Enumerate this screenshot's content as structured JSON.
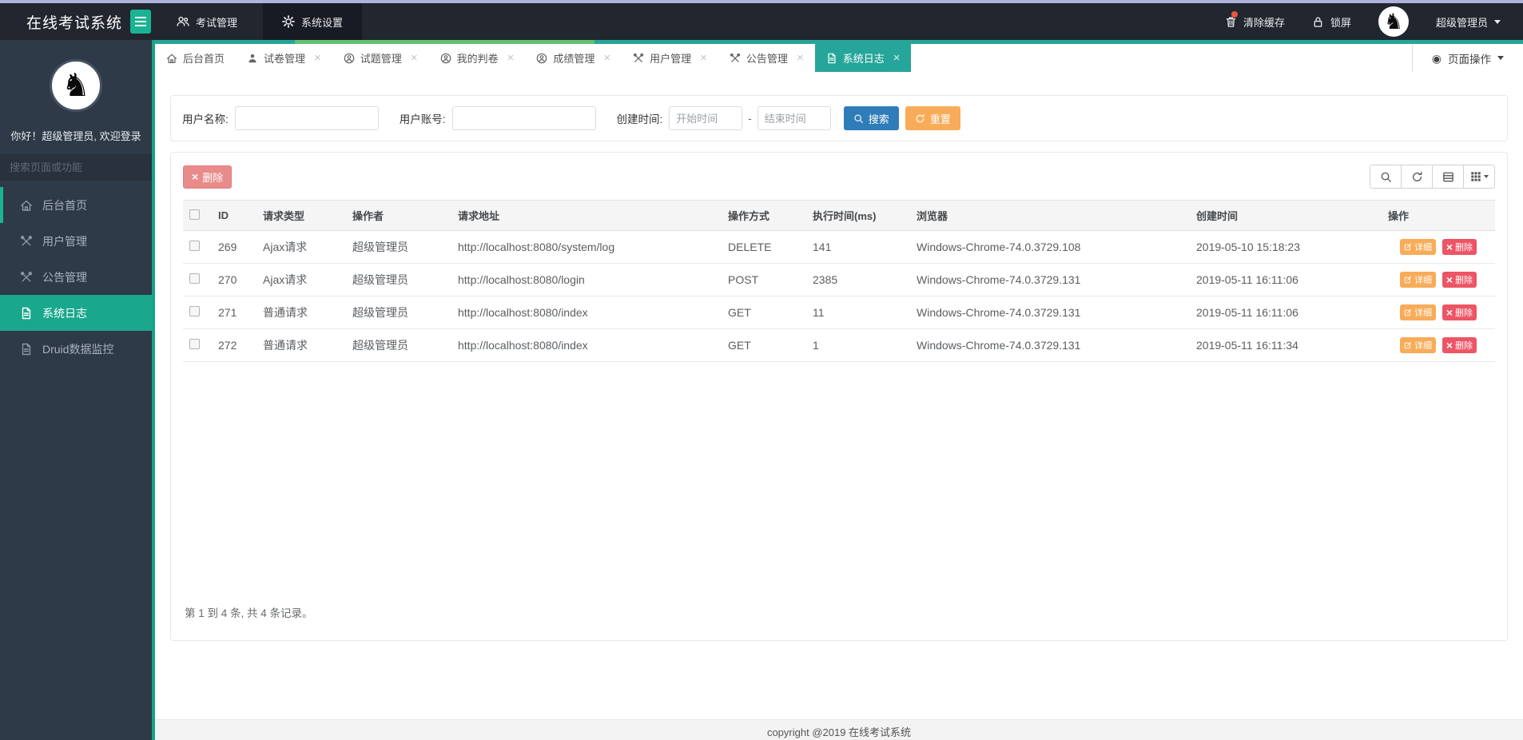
{
  "topbar": {
    "title": "在线考试系统",
    "nav": [
      {
        "label": "考试管理",
        "icon": "users-icon"
      },
      {
        "label": "系统设置",
        "icon": "gear-icon",
        "active": true
      }
    ],
    "actions": {
      "clear_cache": "清除缓存",
      "lock_screen": "锁屏",
      "username": "超级管理员"
    }
  },
  "sidebar": {
    "greeting": "你好！超级管理员, 欢迎登录",
    "search_placeholder": "搜索页面或功能",
    "items": [
      {
        "label": "后台首页",
        "icon": "home-icon"
      },
      {
        "label": "用户管理",
        "icon": "tools-icon"
      },
      {
        "label": "公告管理",
        "icon": "tools-icon"
      },
      {
        "label": "系统日志",
        "icon": "file-icon",
        "active": true
      },
      {
        "label": "Druid数据监控",
        "icon": "file-icon"
      }
    ]
  },
  "tabs": {
    "page_ops": "页面操作",
    "items": [
      {
        "label": "后台首页",
        "icon": "home-icon",
        "closable": false
      },
      {
        "label": "试卷管理",
        "icon": "user-icon",
        "closable": true
      },
      {
        "label": "试题管理",
        "icon": "user-circle-icon",
        "closable": true
      },
      {
        "label": "我的判卷",
        "icon": "user-circle-icon",
        "closable": true
      },
      {
        "label": "成绩管理",
        "icon": "user-circle-icon",
        "closable": true
      },
      {
        "label": "用户管理",
        "icon": "tools-icon",
        "closable": true
      },
      {
        "label": "公告管理",
        "icon": "tools-icon",
        "closable": true
      },
      {
        "label": "系统日志",
        "icon": "file-icon",
        "closable": true,
        "active": true
      }
    ]
  },
  "filter": {
    "username_label": "用户名称:",
    "account_label": "用户账号:",
    "created_label": "创建时间:",
    "start_placeholder": "开始时间",
    "end_placeholder": "结束时间",
    "separator": "-",
    "search_label": "搜索",
    "reset_label": "重置"
  },
  "toolbar": {
    "delete_label": "删除"
  },
  "table": {
    "headers": [
      "ID",
      "请求类型",
      "操作者",
      "请求地址",
      "操作方式",
      "执行时间(ms)",
      "浏览器",
      "创建时间",
      "操作"
    ],
    "actions": {
      "detail": "详细",
      "remove": "删除"
    },
    "rows": [
      {
        "id": "269",
        "type": "Ajax请求",
        "operator": "超级管理员",
        "url": "http://localhost:8080/system/log",
        "method": "DELETE",
        "time": "141",
        "browser": "Windows-Chrome-74.0.3729.108",
        "created": "2019-05-10 15:18:23"
      },
      {
        "id": "270",
        "type": "Ajax请求",
        "operator": "超级管理员",
        "url": "http://localhost:8080/login",
        "method": "POST",
        "time": "2385",
        "browser": "Windows-Chrome-74.0.3729.131",
        "created": "2019-05-11 16:11:06"
      },
      {
        "id": "271",
        "type": "普通请求",
        "operator": "超级管理员",
        "url": "http://localhost:8080/index",
        "method": "GET",
        "time": "11",
        "browser": "Windows-Chrome-74.0.3729.131",
        "created": "2019-05-11 16:11:06"
      },
      {
        "id": "272",
        "type": "普通请求",
        "operator": "超级管理员",
        "url": "http://localhost:8080/index",
        "method": "GET",
        "time": "1",
        "browser": "Windows-Chrome-74.0.3729.131",
        "created": "2019-05-11 16:11:34"
      }
    ]
  },
  "summary": "第 1 到 4 条, 共 4 条记录。",
  "footer": "copyright @2019 在线考试系统",
  "colors": {
    "accent": "#1ab394",
    "tab_active": "#26a69a",
    "search_btn": "#2e7cb8",
    "warning": "#f8ac59",
    "danger": "#ed5565",
    "navbar": "#22262f",
    "sidebar": "#2e3a47"
  }
}
